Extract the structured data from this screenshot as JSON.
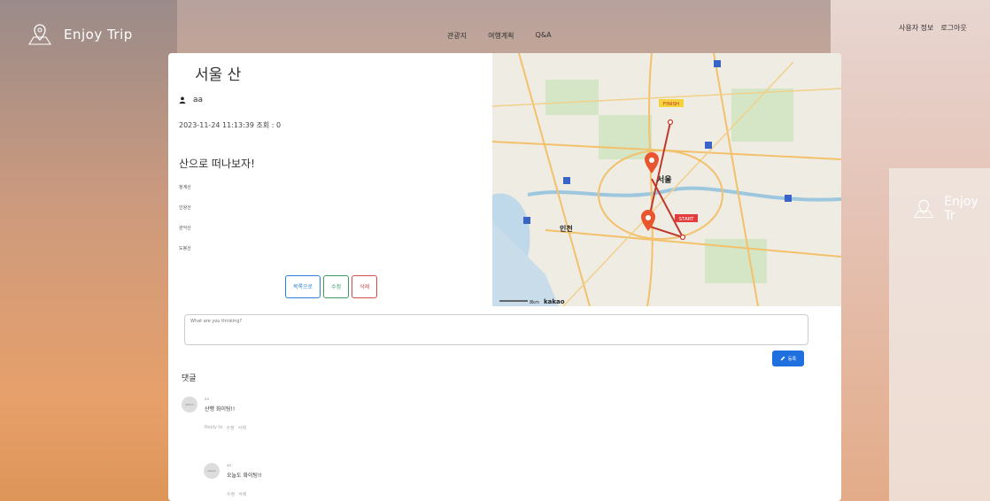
{
  "brand": {
    "name": "Enjoy Trip"
  },
  "nav": {
    "links": [
      "관광지",
      "여행계획",
      "Q&A"
    ],
    "right": [
      "사용자 정보",
      "로그아웃"
    ]
  },
  "post": {
    "title": "서울 산",
    "author": "aa",
    "meta": "2023-11-24 11:13:39 조회 : 0",
    "subtitle": "산으로 떠나보자!",
    "list": [
      "청계산",
      "인왕산",
      "관악산",
      "도봉산"
    ],
    "buttons": {
      "list": "목록으로",
      "edit": "수정",
      "delete": "삭제"
    }
  },
  "map": {
    "labels": {
      "finish": "FINISH",
      "start": "START",
      "seoul": "서울",
      "incheon": "인천",
      "kakao": "kakao",
      "scale": "8km"
    }
  },
  "comment_form": {
    "placeholder": "What are you thinking?",
    "submit": "등록"
  },
  "comments_label": "댓글",
  "comments": [
    {
      "name": "aa",
      "text": "산행 화이팅!!",
      "actions": [
        "Reply to",
        "수정",
        "삭제"
      ],
      "avatar": "admin"
    },
    {
      "name": "aa",
      "text": "오늘도 화이팅!!",
      "actions": [
        "수정",
        "삭제"
      ],
      "avatar": "admin"
    }
  ],
  "ghost": {
    "brand": "Enjoy Tr"
  },
  "colors": {
    "accent": "#1f6fde",
    "danger": "#d24a4a",
    "success": "#3c9a62"
  }
}
